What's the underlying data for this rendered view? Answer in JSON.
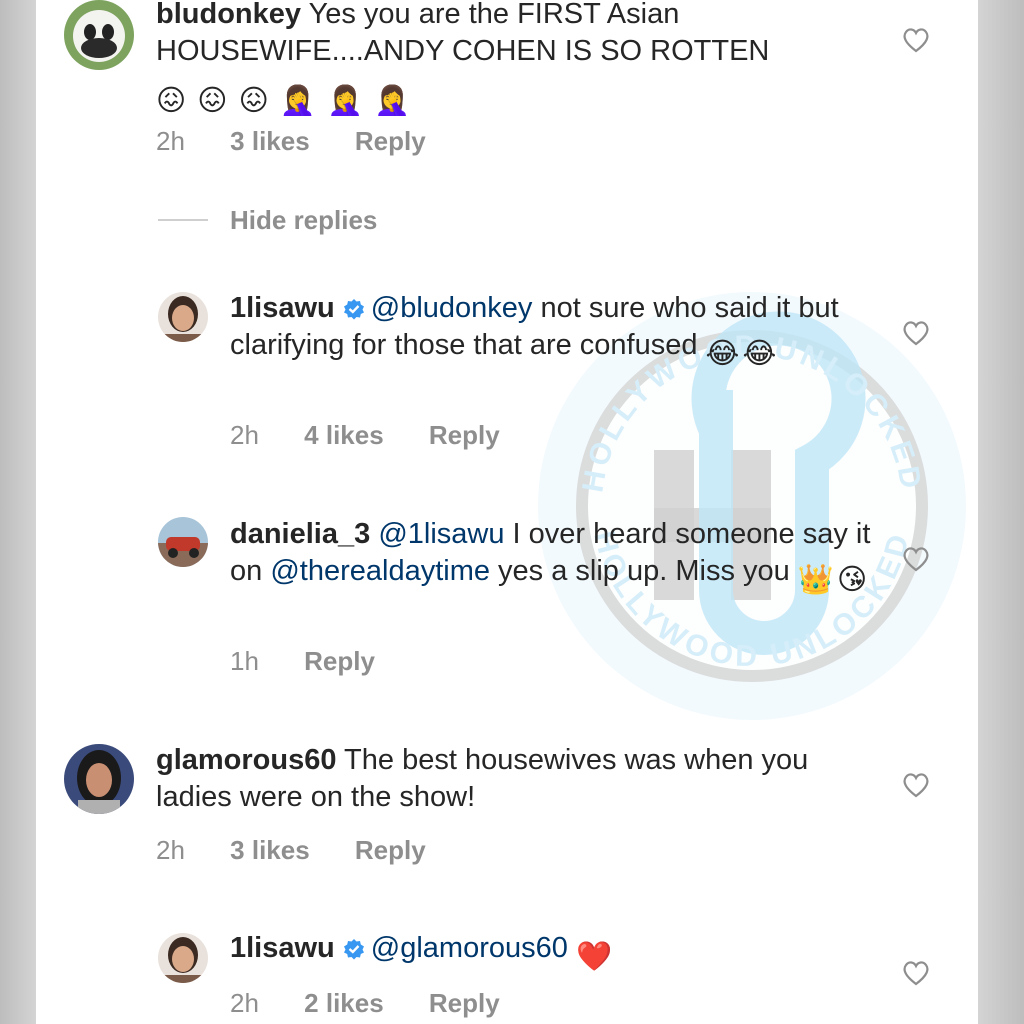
{
  "watermark": {
    "ring_text_top": "HOLLYWOOD UNLOCKED",
    "ring_text_bottom": "HOLLYWOOD UNLOCKED",
    "color": "#38b6e8"
  },
  "comments": [
    {
      "username": "bludonkey",
      "text": "Yes you are the FIRST Asian HOUSEWIFE....ANDY COHEN IS SO ROTTEN",
      "emojis": [
        "😖",
        "😖",
        "😖",
        "🤦‍♀️",
        "🤦‍♀️",
        "🤦‍♀️"
      ],
      "time": "2h",
      "likes": "3 likes",
      "reply": "Reply"
    },
    {
      "hide_replies": "Hide replies"
    },
    {
      "username": "1lisawu",
      "verified": true,
      "mention": "@bludonkey",
      "text": "not sure who said it but clarifying for those that are confused",
      "emojis": [
        "😂",
        "😂"
      ],
      "time": "2h",
      "likes": "4 likes",
      "reply": "Reply"
    },
    {
      "username": "danielia_3",
      "mention": "@1lisawu",
      "text_a": "I over heard someone say it on",
      "mention2": "@therealdaytime",
      "text_b": "yes a slip up. Miss you",
      "emojis": [
        "👑",
        "😘"
      ],
      "time": "1h",
      "reply": "Reply"
    },
    {
      "username": "glamorous60",
      "text": "The best housewives was when you ladies were on the show!",
      "time": "2h",
      "likes": "3 likes",
      "reply": "Reply"
    },
    {
      "username": "1lisawu",
      "verified": true,
      "mention": "@glamorous60",
      "emojis": [
        "❤️"
      ],
      "time": "2h",
      "likes": "2 likes",
      "reply": "Reply"
    }
  ],
  "colors": {
    "mention": "#00376b",
    "meta": "#8e8e8e",
    "verified": "#3897f0",
    "heart_outline": "#8e8e8e"
  }
}
